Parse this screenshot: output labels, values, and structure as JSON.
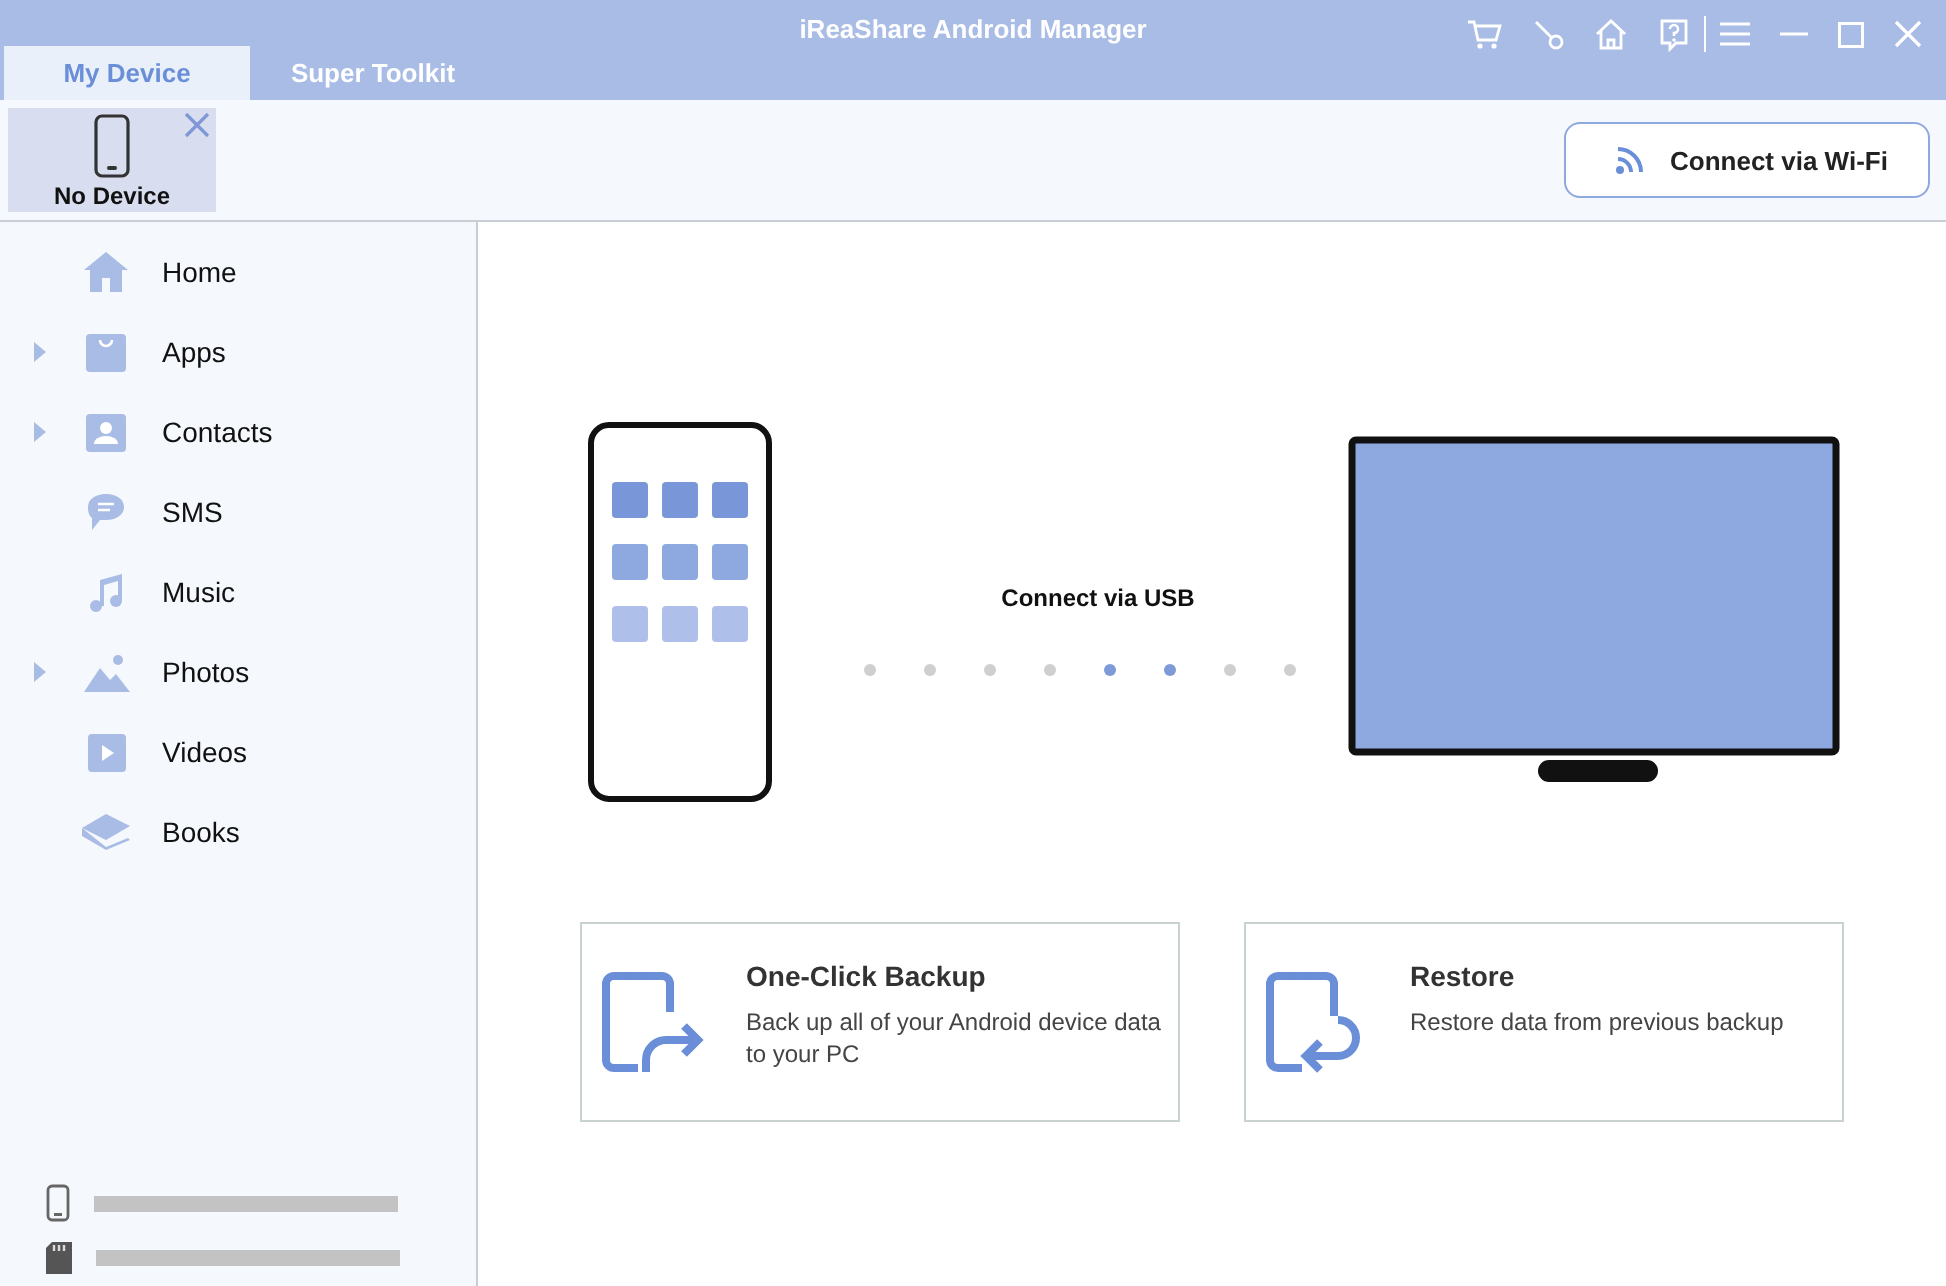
{
  "window": {
    "title": "iReaShare Android Manager"
  },
  "tabs": [
    {
      "label": "My Device",
      "selected": true
    },
    {
      "label": "Super Toolkit",
      "selected": false
    }
  ],
  "device": {
    "label": "No Device",
    "selected": true
  },
  "wifi_button": {
    "label": "Connect via Wi-Fi"
  },
  "sidebar": {
    "items": [
      {
        "kind": "home",
        "label": "Home",
        "expandable": false
      },
      {
        "kind": "apps",
        "label": "Apps",
        "expandable": true
      },
      {
        "kind": "contacts",
        "label": "Contacts",
        "expandable": true
      },
      {
        "kind": "sms",
        "label": "SMS",
        "expandable": false
      },
      {
        "kind": "music",
        "label": "Music",
        "expandable": false
      },
      {
        "kind": "photos",
        "label": "Photos",
        "expandable": true
      },
      {
        "kind": "videos",
        "label": "Videos",
        "expandable": false
      },
      {
        "kind": "books",
        "label": "Books",
        "expandable": false
      }
    ]
  },
  "connection": {
    "label": "Connect via USB",
    "dots": [
      {
        "active": false
      },
      {
        "active": false
      },
      {
        "active": false
      },
      {
        "active": false
      },
      {
        "active": true
      },
      {
        "active": true
      },
      {
        "active": false
      },
      {
        "active": false
      }
    ]
  },
  "cards": [
    {
      "kind": "backup",
      "title": "One-Click Backup",
      "text": "Back up all of your Android device data to your PC"
    },
    {
      "kind": "restore",
      "title": "Restore",
      "text": "Restore data from previous backup"
    }
  ]
}
